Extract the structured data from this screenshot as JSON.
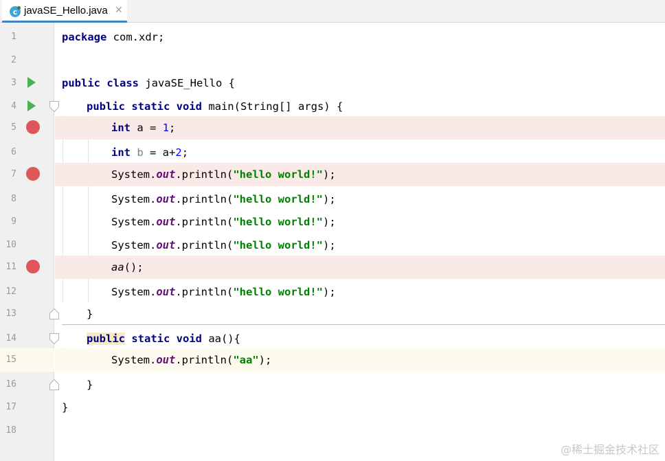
{
  "tab": {
    "filename": "javaSE_Hello.java",
    "icon": "java-class-icon",
    "close_glyph": "✕"
  },
  "colors": {
    "keyword": "#000080",
    "string": "#008000",
    "field": "#660e7a",
    "number": "#0000ff",
    "breakpoint": "#e0575b",
    "breakpoint_line": "#faeae7",
    "current_line": "#fcfaed",
    "run_gutter": "#4caf50"
  },
  "lines": [
    {
      "n": "1",
      "parts": {
        "kw": "package",
        "rest": " com.xdr;"
      }
    },
    {
      "n": "2"
    },
    {
      "n": "3",
      "parts": {
        "kw": "public class",
        "rest": " javaSE_Hello {"
      }
    },
    {
      "n": "4",
      "parts": {
        "kw": "public static void",
        "rest": " main(String[] args) {"
      }
    },
    {
      "n": "5",
      "parts": {
        "kw": "int",
        "a": " a = ",
        "num": "1",
        "end": ";"
      }
    },
    {
      "n": "6",
      "parts": {
        "kw": "int",
        "b": " b",
        "mid": " = a+",
        "num": "2",
        "end": ";"
      }
    },
    {
      "n": "7",
      "parts": {
        "sys": "System.",
        "out": "out",
        "println": ".println(",
        "str": "\"hello world!\"",
        "end": ");"
      }
    },
    {
      "n": "8",
      "parts": {
        "sys": "System.",
        "out": "out",
        "println": ".println(",
        "str": "\"hello world!\"",
        "end": ");"
      }
    },
    {
      "n": "9",
      "parts": {
        "sys": "System.",
        "out": "out",
        "println": ".println(",
        "str": "\"hello world!\"",
        "end": ");"
      }
    },
    {
      "n": "10",
      "parts": {
        "sys": "System.",
        "out": "out",
        "println": ".println(",
        "str": "\"hello world!\"",
        "end": ");"
      }
    },
    {
      "n": "11",
      "parts": {
        "call": "aa",
        "end": "();"
      }
    },
    {
      "n": "12",
      "parts": {
        "sys": "System.",
        "out": "out",
        "println": ".println(",
        "str": "\"hello world!\"",
        "end": ");"
      }
    },
    {
      "n": "13",
      "parts": {
        "rest": "}"
      }
    },
    {
      "n": "14",
      "parts": {
        "kw_hl": "public",
        "kw": " static void",
        "rest": " aa(){"
      }
    },
    {
      "n": "15",
      "parts": {
        "sys": "System.",
        "out": "out",
        "println": ".println(",
        "str": "\"aa\"",
        "end": ");"
      }
    },
    {
      "n": "16",
      "parts": {
        "rest": "}"
      }
    },
    {
      "n": "17",
      "parts": {
        "rest": "}"
      }
    },
    {
      "n": "18"
    }
  ],
  "watermark": "@稀土掘金技术社区"
}
